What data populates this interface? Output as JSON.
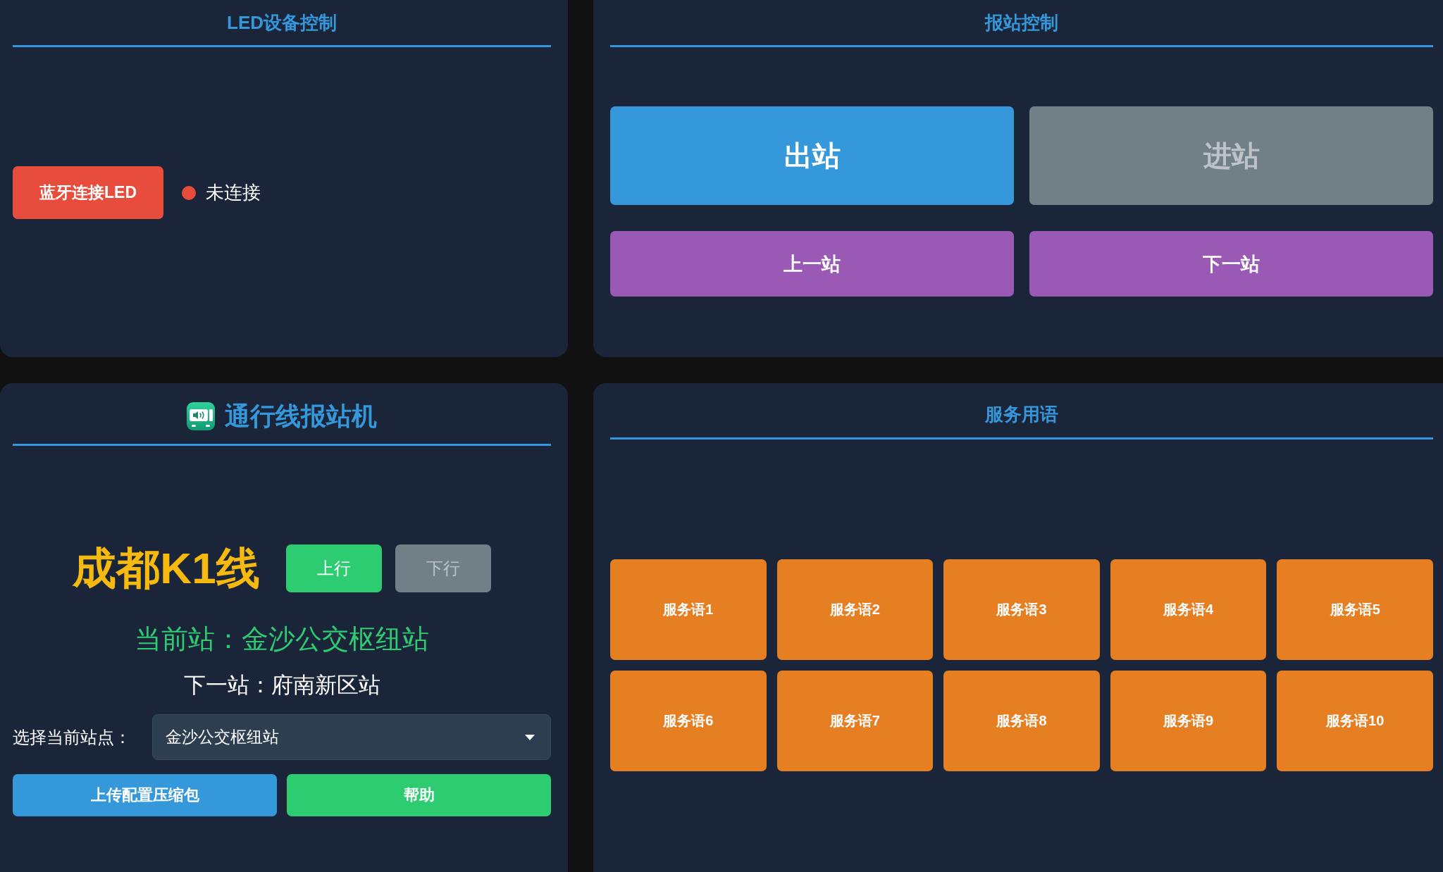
{
  "led_panel": {
    "title": "LED设备控制",
    "connect_button": "蓝牙连接LED",
    "status": {
      "label": "未连接",
      "connected": false
    }
  },
  "announce_panel": {
    "title": "报站控制",
    "stop_buttons": [
      {
        "label": "出站",
        "disabled": false
      },
      {
        "label": "进站",
        "disabled": true
      }
    ],
    "nav_buttons": [
      "上一站",
      "下一站"
    ]
  },
  "line_panel": {
    "title": "通行线报站机",
    "line_name": "成都K1线",
    "directions": [
      {
        "label": "上行",
        "selected": true
      },
      {
        "label": "下行",
        "selected": false
      }
    ],
    "current_station": "当前站：金沙公交枢纽站",
    "next_station": "下一站：府南新区站",
    "station_select": {
      "label": "选择当前站点：",
      "value": "金沙公交枢纽站"
    },
    "buttons": [
      {
        "label": "上传配置压缩包",
        "kind": "upload"
      },
      {
        "label": "帮助",
        "kind": "help"
      }
    ]
  },
  "service_panel": {
    "title": "服务用语",
    "phrases": [
      "服务语1",
      "服务语2",
      "服务语3",
      "服务语4",
      "服务语5",
      "服务语6",
      "服务语7",
      "服务语8",
      "服务语9",
      "服务语10"
    ]
  }
}
